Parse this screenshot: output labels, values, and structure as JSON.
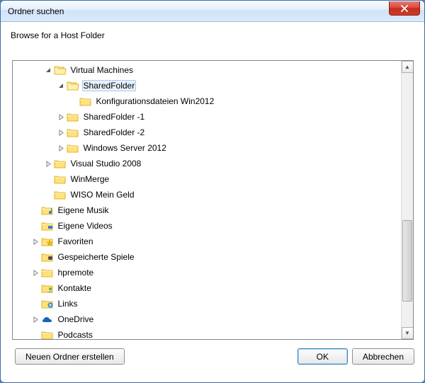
{
  "window": {
    "title": "Ordner suchen",
    "close_icon": "close"
  },
  "instruction": "Browse for a Host Folder",
  "tree": [
    {
      "level": 2,
      "expander": "expanded",
      "icon": "folder-open",
      "label": "Virtual Machines",
      "selected": false
    },
    {
      "level": 3,
      "expander": "expanded",
      "icon": "folder-open",
      "label": "SharedFolder",
      "selected": true
    },
    {
      "level": 4,
      "expander": "none",
      "icon": "folder",
      "label": "Konfigurationsdateien Win2012",
      "selected": false
    },
    {
      "level": 3,
      "expander": "collapsed",
      "icon": "folder",
      "label": "SharedFolder -1",
      "selected": false
    },
    {
      "level": 3,
      "expander": "collapsed",
      "icon": "folder",
      "label": "SharedFolder -2",
      "selected": false
    },
    {
      "level": 3,
      "expander": "collapsed",
      "icon": "folder",
      "label": "Windows Server 2012",
      "selected": false
    },
    {
      "level": 2,
      "expander": "collapsed",
      "icon": "folder",
      "label": "Visual Studio 2008",
      "selected": false
    },
    {
      "level": 2,
      "expander": "none",
      "icon": "folder",
      "label": "WinMerge",
      "selected": false
    },
    {
      "level": 2,
      "expander": "none",
      "icon": "folder",
      "label": "WISO Mein Geld",
      "selected": false
    },
    {
      "level": 1,
      "expander": "none",
      "icon": "folder-music",
      "label": "Eigene Musik",
      "selected": false
    },
    {
      "level": 1,
      "expander": "none",
      "icon": "folder-video",
      "label": "Eigene Videos",
      "selected": false
    },
    {
      "level": 1,
      "expander": "collapsed",
      "icon": "favorites",
      "label": "Favoriten",
      "selected": false
    },
    {
      "level": 1,
      "expander": "none",
      "icon": "games",
      "label": "Gespeicherte Spiele",
      "selected": false
    },
    {
      "level": 1,
      "expander": "collapsed",
      "icon": "folder",
      "label": "hpremote",
      "selected": false
    },
    {
      "level": 1,
      "expander": "none",
      "icon": "contacts",
      "label": "Kontakte",
      "selected": false
    },
    {
      "level": 1,
      "expander": "none",
      "icon": "links",
      "label": "Links",
      "selected": false
    },
    {
      "level": 1,
      "expander": "collapsed",
      "icon": "onedrive",
      "label": "OneDrive",
      "selected": false
    },
    {
      "level": 1,
      "expander": "none",
      "icon": "folder",
      "label": "Podcasts",
      "selected": false
    }
  ],
  "buttons": {
    "new_folder": "Neuen Ordner erstellen",
    "ok": "OK",
    "cancel": "Abbrechen"
  }
}
